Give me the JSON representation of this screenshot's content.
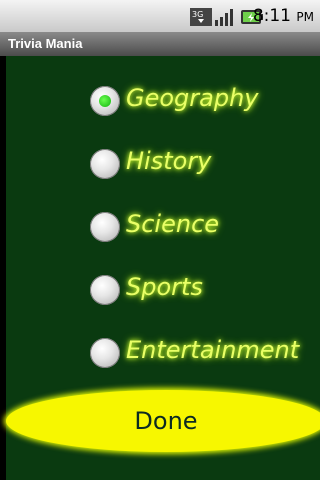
{
  "status_bar": {
    "time": "8:11",
    "time_suffix": "PM",
    "network_label": "3G",
    "icons": [
      "3g-data-icon",
      "signal-strength-icon",
      "battery-charging-icon"
    ]
  },
  "app": {
    "title": "Trivia Mania"
  },
  "categories": {
    "items": [
      {
        "label": "Geography",
        "checked": true
      },
      {
        "label": "History",
        "checked": false
      },
      {
        "label": "Science",
        "checked": false
      },
      {
        "label": "Sports",
        "checked": false
      },
      {
        "label": "Entertainment",
        "checked": false
      }
    ]
  },
  "done_button": {
    "label": "Done"
  },
  "colors": {
    "background": "#0a3a10",
    "label_glow": "#e9ff66",
    "button": "#f7f700"
  }
}
